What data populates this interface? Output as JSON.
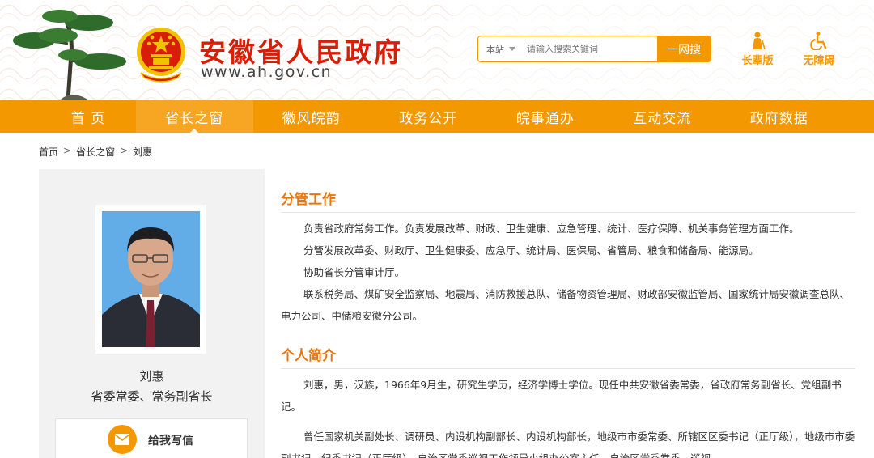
{
  "header": {
    "title": "安徽省人民政府",
    "url": "www.ah.gov.cn",
    "search": {
      "scope": "本站",
      "placeholder": "请输入搜索关键词",
      "button": "一网搜"
    },
    "tools": [
      {
        "label": "长辈版",
        "icon": "elder-icon"
      },
      {
        "label": "无障碍",
        "icon": "accessibility-icon"
      }
    ],
    "colors": {
      "brand_red": "#d81e06",
      "accent_orange": "#f39800"
    }
  },
  "nav": {
    "items": [
      "首 页",
      "省长之窗",
      "徽风皖韵",
      "政务公开",
      "皖事通办",
      "互动交流",
      "政府数据"
    ],
    "active_index": 1
  },
  "breadcrumb": [
    "首页",
    "省长之窗",
    "刘惠"
  ],
  "breadcrumb_sep": ">",
  "profile": {
    "name": "刘惠",
    "title": "省委常委、常务副省长",
    "mail_label": "给我写信"
  },
  "sections": {
    "duties": {
      "heading": "分管工作",
      "paragraphs": [
        "负责省政府常务工作。负责发展改革、财政、卫生健康、应急管理、统计、医疗保障、机关事务管理方面工作。",
        "分管发展改革委、财政厅、卫生健康委、应急厅、统计局、医保局、省管局、粮食和储备局、能源局。",
        "协助省长分管审计厅。",
        "联系税务局、煤矿安全监察局、地震局、消防救援总队、储备物资管理局、财政部安徽监管局、国家统计局安徽调查总队、电力公司、中储粮安徽分公司。"
      ]
    },
    "bio": {
      "heading": "个人简介",
      "paragraphs": [
        "刘惠，男，汉族，1966年9月生，研究生学历，经济学博士学位。现任中共安徽省委常委，省政府常务副省长、党组副书记。",
        "曾任国家机关副处长、调研员、内设机构副部长、内设机构部长，地级市市委常委、所辖区区委书记（正厅级），地级市市委副书记、纪委书记（正厅级），自治区党委巡视工作领导小组办公室主任，自治区党委常委、巡视"
      ]
    }
  }
}
